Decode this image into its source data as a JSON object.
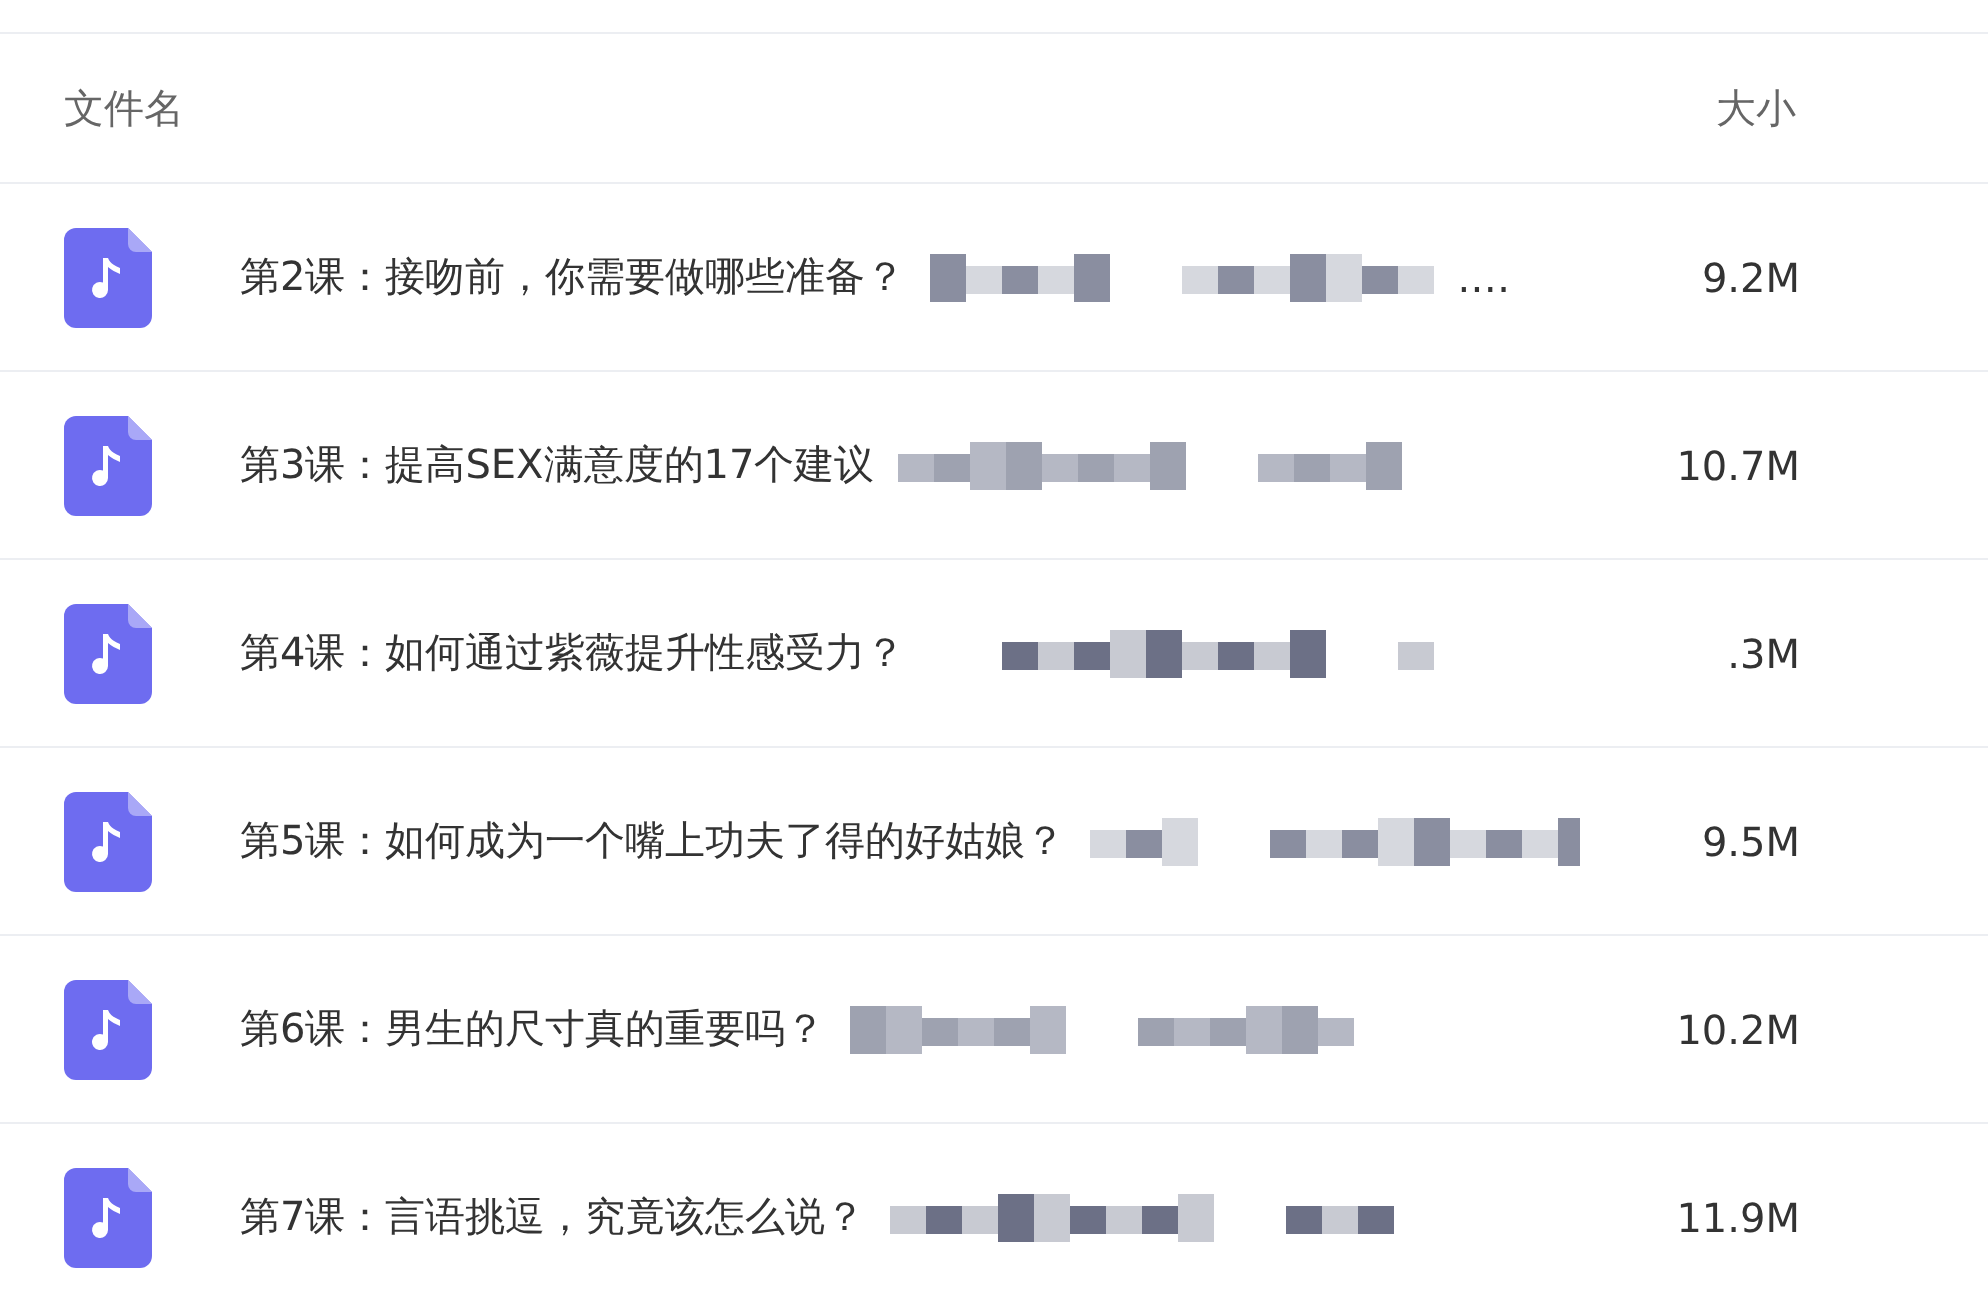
{
  "columns": [
    {
      "label": "文件名"
    },
    {
      "label": "大小"
    }
  ],
  "files": [
    {
      "name": "第2课：接吻前，你需要做哪些准备？",
      "trail": ".…",
      "size": "9.2M"
    },
    {
      "name": "第3课：提高SEX满意度的17个建议",
      "size": "10.7M"
    },
    {
      "name": "第4课：如何通过紫薇提升性感受力？",
      "size": ".3M"
    },
    {
      "name": "第5课：如何成为一个嘴上功夫了得的好姑娘？",
      "size": "9.5M"
    },
    {
      "name": "第6课：男生的尺寸真的重要吗？",
      "size": "10.2M"
    },
    {
      "name": "第7课：言语挑逗，究竟该怎么说？",
      "size": "11.9M"
    }
  ]
}
